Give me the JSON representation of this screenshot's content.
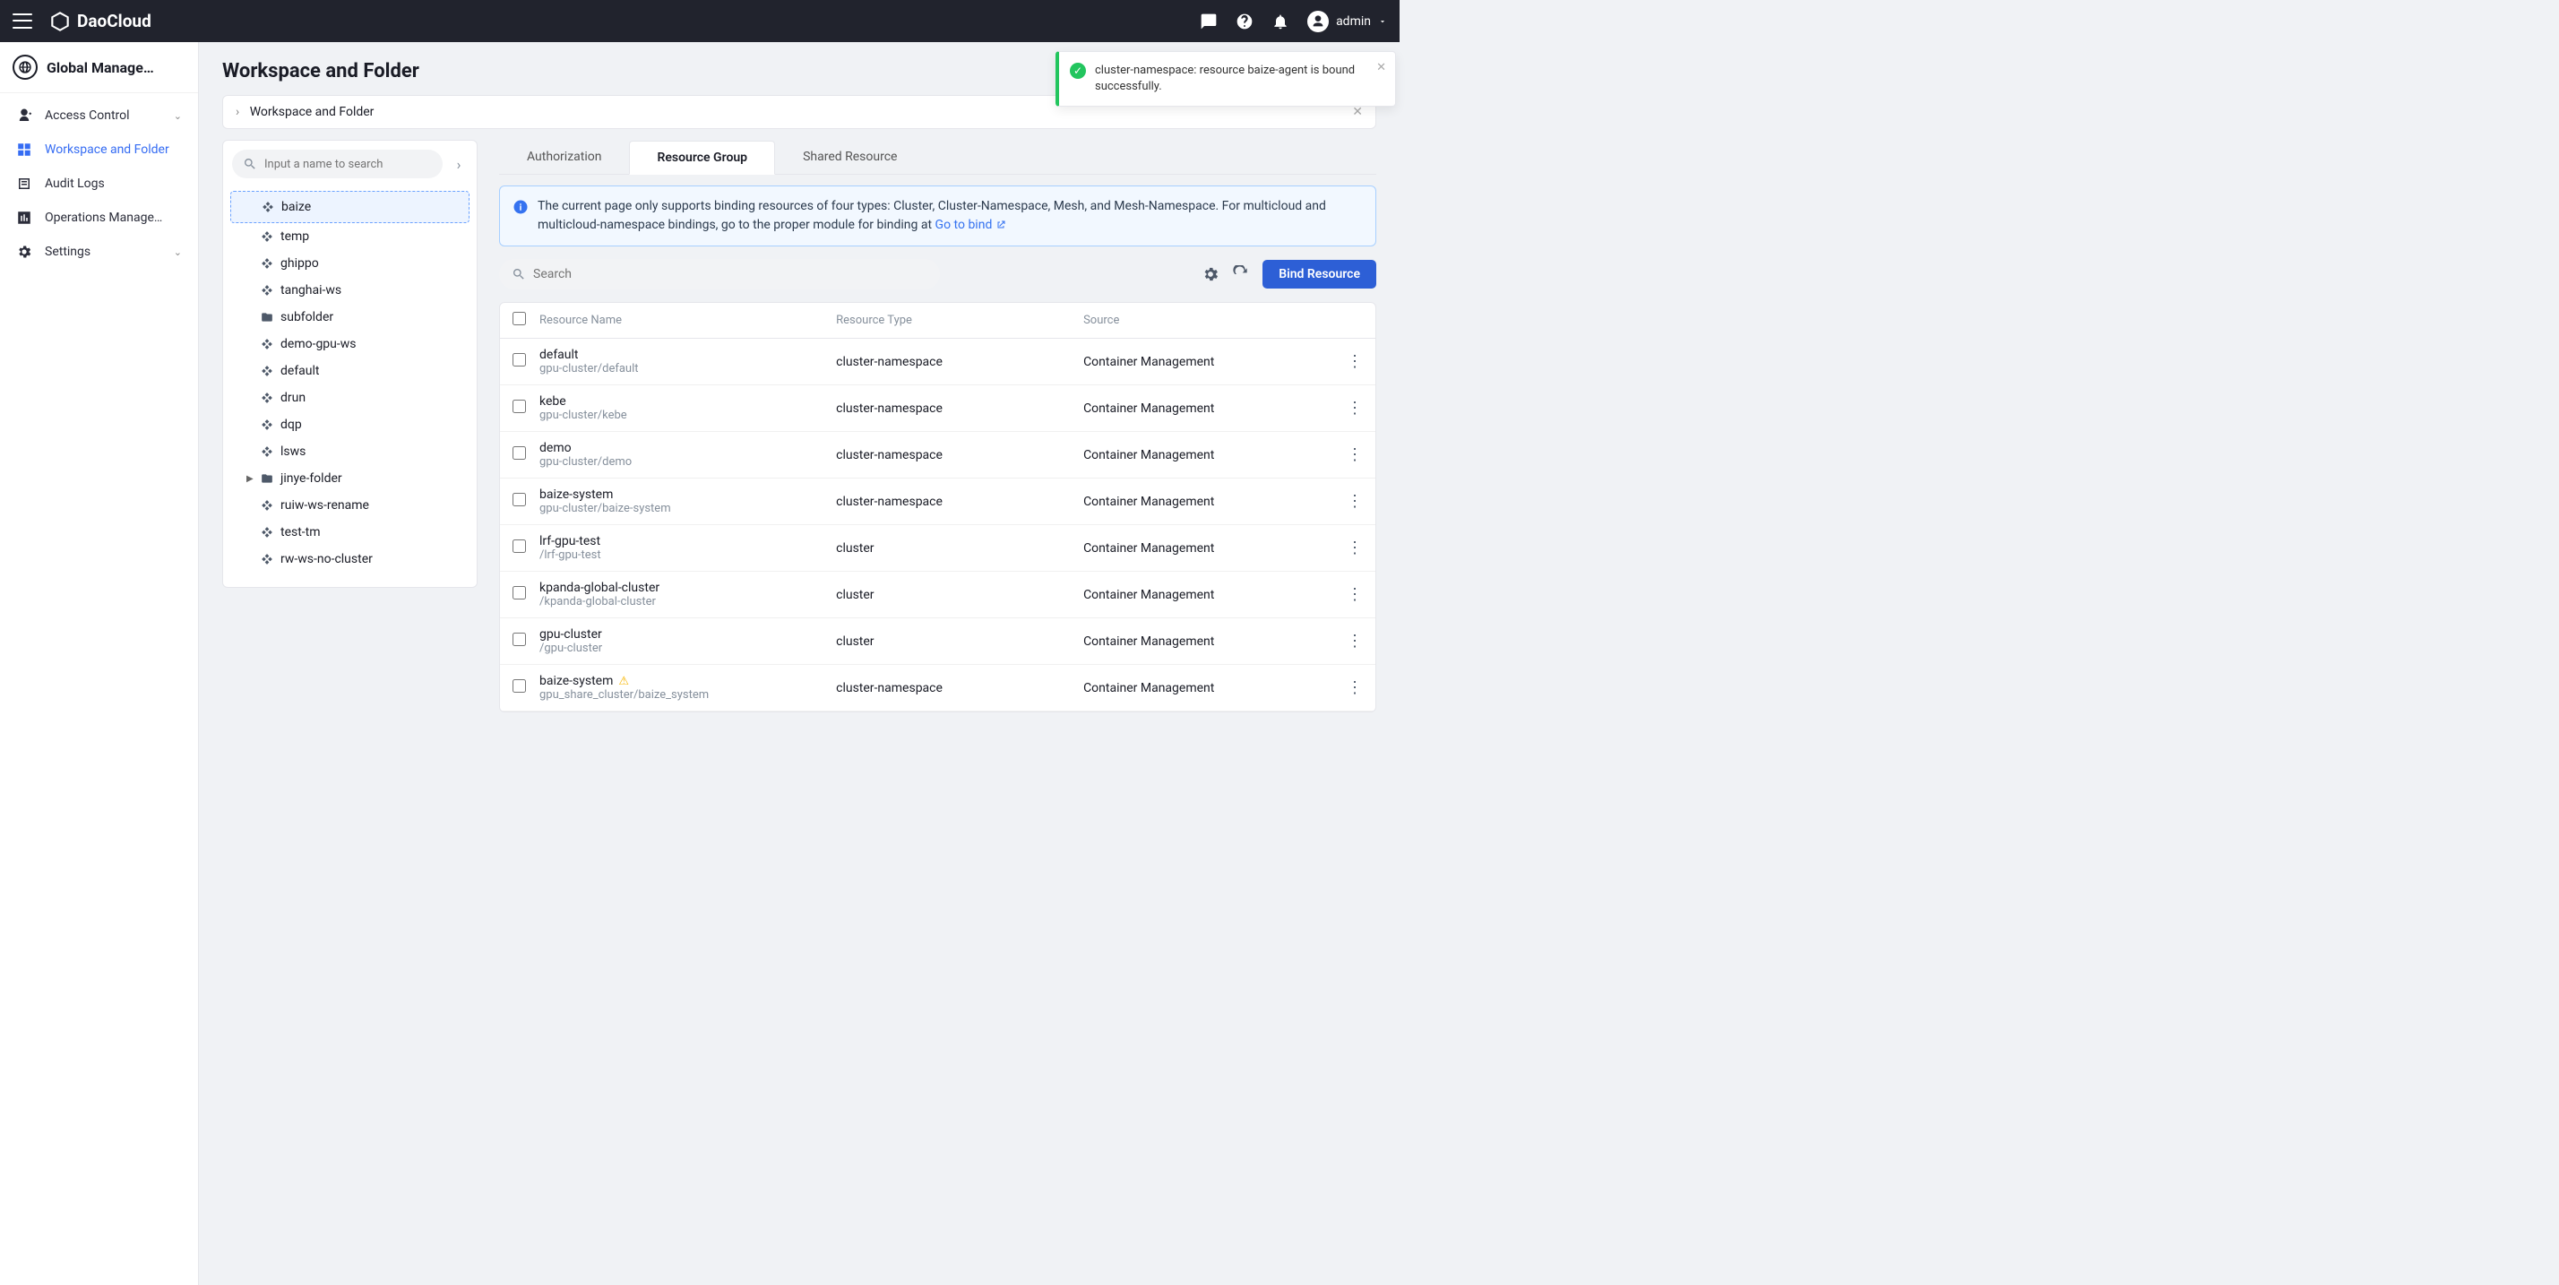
{
  "header": {
    "brand": "DaoCloud",
    "user": "admin"
  },
  "sidebar": {
    "section_title": "Global Manage…",
    "items": [
      {
        "label": "Access Control",
        "expandable": true
      },
      {
        "label": "Workspace and Folder",
        "active": true
      },
      {
        "label": "Audit Logs"
      },
      {
        "label": "Operations Manage…"
      },
      {
        "label": "Settings",
        "expandable": true
      }
    ]
  },
  "page": {
    "title": "Workspace and Folder",
    "breadcrumb": "Workspace and Folder"
  },
  "tree": {
    "search_placeholder": "Input a name to search",
    "items": [
      {
        "label": "baize",
        "selected": true,
        "icon": "shape"
      },
      {
        "label": "temp",
        "icon": "shape"
      },
      {
        "label": "ghippo",
        "icon": "shape"
      },
      {
        "label": "tanghai-ws",
        "icon": "shape"
      },
      {
        "label": "subfolder",
        "icon": "folder"
      },
      {
        "label": "demo-gpu-ws",
        "icon": "shape"
      },
      {
        "label": "default",
        "icon": "shape"
      },
      {
        "label": "drun",
        "icon": "shape"
      },
      {
        "label": "dqp",
        "icon": "shape"
      },
      {
        "label": "lsws",
        "icon": "shape"
      },
      {
        "label": "jinye-folder",
        "icon": "folder",
        "expandable": true
      },
      {
        "label": "ruiw-ws-rename",
        "icon": "shape"
      },
      {
        "label": "test-tm",
        "icon": "shape"
      },
      {
        "label": "rw-ws-no-cluster",
        "icon": "shape"
      }
    ]
  },
  "tabs": {
    "items": [
      "Authorization",
      "Resource Group",
      "Shared Resource"
    ],
    "active_index": 1
  },
  "banner": {
    "text": "The current page only supports binding resources of four types: Cluster, Cluster-Namespace, Mesh, and Mesh-Namespace. For multicloud and multicloud-namespace bindings, go to the proper module for binding at ",
    "link_text": "Go to bind"
  },
  "toolbar": {
    "search_placeholder": "Search",
    "bind_button": "Bind Resource"
  },
  "table": {
    "headers": {
      "name": "Resource Name",
      "type": "Resource Type",
      "source": "Source"
    },
    "rows": [
      {
        "name": "default",
        "sub": "gpu-cluster/default",
        "type": "cluster-namespace",
        "source": "Container Management"
      },
      {
        "name": "kebe",
        "sub": "gpu-cluster/kebe",
        "type": "cluster-namespace",
        "source": "Container Management"
      },
      {
        "name": "demo",
        "sub": "gpu-cluster/demo",
        "type": "cluster-namespace",
        "source": "Container Management"
      },
      {
        "name": "baize-system",
        "sub": "gpu-cluster/baize-system",
        "type": "cluster-namespace",
        "source": "Container Management"
      },
      {
        "name": "lrf-gpu-test",
        "sub": "/lrf-gpu-test",
        "type": "cluster",
        "source": "Container Management"
      },
      {
        "name": "kpanda-global-cluster",
        "sub": "/kpanda-global-cluster",
        "type": "cluster",
        "source": "Container Management"
      },
      {
        "name": "gpu-cluster",
        "sub": "/gpu-cluster",
        "type": "cluster",
        "source": "Container Management"
      },
      {
        "name": "baize-system",
        "sub": "gpu_share_cluster/baize_system",
        "type": "cluster-namespace",
        "source": "Container Management",
        "warn": true
      }
    ]
  },
  "toast": {
    "text": "cluster-namespace: resource baize-agent is bound successfully."
  }
}
